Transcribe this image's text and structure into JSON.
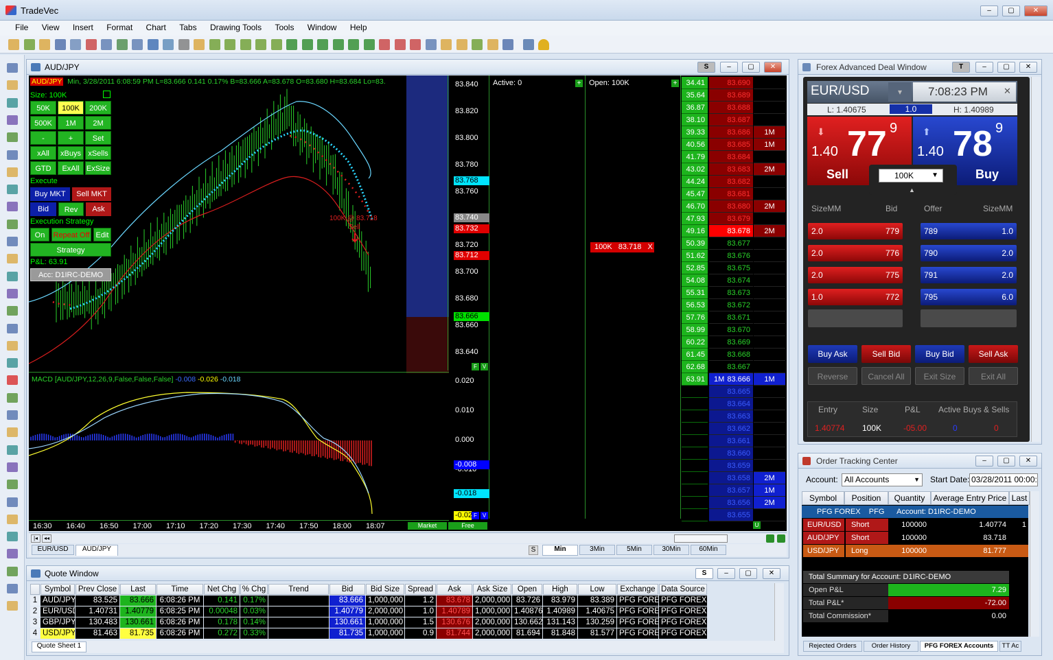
{
  "app": {
    "title": "TradeVec"
  },
  "menu": [
    "File",
    "View",
    "Insert",
    "Format",
    "Chart",
    "Tabs",
    "Drawing Tools",
    "Tools",
    "Window",
    "Help"
  ],
  "chart": {
    "title": "AUD/JPY",
    "header_symbol": "AUD/JPY",
    "header_info": "Min, 3/28/2011  6:08:59 PM  L=83.666  0.141  0.17%  B=83.666  A=83.678  O=83.680  H=83.684  Lo=83.",
    "size_label": "Size: 100K",
    "size_btns": [
      "50K",
      "100K",
      "200K",
      "500K",
      "1M",
      "2M",
      "-",
      "+",
      "Set",
      "xAll",
      "xBuys",
      "xSells",
      "GTD",
      "ExAll",
      "ExSize"
    ],
    "execute_label": "Execute",
    "buy_mkt": "Buy MKT",
    "sell_mkt": "Sell MKT",
    "bid": "Bid",
    "rev": "Rev",
    "ask": "Ask",
    "exec_strategy_label": "Execution Strategy",
    "on": "On",
    "repeat_off": "Repeat Off",
    "edit": "Edit",
    "strategy": "Strategy",
    "pnl": "P&L: 63.91",
    "account": "Acc: D1IRC-DEMO",
    "annotation": "100K @ 83.718",
    "annotation_sell": "Sell",
    "price_axis": [
      "83.840",
      "83.820",
      "83.800",
      "83.780",
      "83.760",
      "83.740",
      "83.720",
      "83.700",
      "83.680",
      "83.660",
      "83.640"
    ],
    "price_tags": [
      {
        "v": "83.768",
        "c": "#00e5ff",
        "fg": "#000"
      },
      {
        "v": "83.740",
        "c": "#888888",
        "fg": "#fff"
      },
      {
        "v": "83.732",
        "c": "#e00000",
        "fg": "#fff"
      },
      {
        "v": "83.712",
        "c": "#e00000",
        "fg": "#fff"
      },
      {
        "v": "83.666",
        "c": "#00e000",
        "fg": "#000"
      }
    ],
    "macd_label": "MACD  [AUD/JPY,12,26,9,False,False,False]",
    "macd_v1": "-0.008",
    "macd_v2": "-0.026",
    "macd_v3": "-0.018",
    "macd_axis": [
      "0.020",
      "0.010",
      "0.000",
      "-0.010"
    ],
    "macd_tags": [
      {
        "v": "-0.008",
        "c": "#0000ff",
        "fg": "#fff"
      },
      {
        "v": "-0.018",
        "c": "#00e5ff",
        "fg": "#000"
      },
      {
        "v": "-0.02",
        "c": "#ffff00",
        "fg": "#000"
      }
    ],
    "time_axis": [
      "16:30",
      "16:40",
      "16:50",
      "17:00",
      "17:10",
      "17:20",
      "17:30",
      "17:40",
      "17:50",
      "18:00",
      "18:07"
    ],
    "tabs": [
      "EUR/USD",
      "AUD/JPY"
    ],
    "intervals": [
      "S",
      "Min",
      "3Min",
      "5Min",
      "30Min",
      "60Min"
    ],
    "market": "Market",
    "free": "Free",
    "active": "Active: 0",
    "open": "Open: 100K",
    "order_tag": "100K",
    "order_price": "83.718",
    "order_x": "X"
  },
  "ladder": {
    "rows": [
      {
        "pl": "34.41",
        "price": "83.690",
        "vol": ""
      },
      {
        "pl": "35.64",
        "price": "83.689",
        "vol": ""
      },
      {
        "pl": "36.87",
        "price": "83.688",
        "vol": ""
      },
      {
        "pl": "38.10",
        "price": "83.687",
        "vol": ""
      },
      {
        "pl": "39.33",
        "price": "83.686",
        "vol": "1M"
      },
      {
        "pl": "40.56",
        "price": "83.685",
        "vol": "1M"
      },
      {
        "pl": "41.79",
        "price": "83.684",
        "vol": ""
      },
      {
        "pl": "43.02",
        "price": "83.683",
        "vol": "2M"
      },
      {
        "pl": "44.24",
        "price": "83.682",
        "vol": ""
      },
      {
        "pl": "45.47",
        "price": "83.681",
        "vol": ""
      },
      {
        "pl": "46.70",
        "price": "83.680",
        "vol": "2M"
      },
      {
        "pl": "47.93",
        "price": "83.679",
        "vol": ""
      },
      {
        "pl": "49.16",
        "price": "83.678",
        "vol": "2M"
      },
      {
        "pl": "50.39",
        "price": "83.677",
        "vol": ""
      },
      {
        "pl": "51.62",
        "price": "83.676",
        "vol": ""
      },
      {
        "pl": "52.85",
        "price": "83.675",
        "vol": ""
      },
      {
        "pl": "54.08",
        "price": "83.674",
        "vol": ""
      },
      {
        "pl": "55.31",
        "price": "83.673",
        "vol": ""
      },
      {
        "pl": "56.53",
        "price": "83.672",
        "vol": ""
      },
      {
        "pl": "57.76",
        "price": "83.671",
        "vol": ""
      },
      {
        "pl": "58.99",
        "price": "83.670",
        "vol": ""
      },
      {
        "pl": "60.22",
        "price": "83.669",
        "vol": ""
      },
      {
        "pl": "61.45",
        "price": "83.668",
        "vol": ""
      },
      {
        "pl": "62.68",
        "price": "83.667",
        "vol": ""
      },
      {
        "pl": "63.91",
        "price": "83.666",
        "vol": "1M",
        "left": "1M"
      },
      {
        "pl": "",
        "price": "83.665",
        "vol": ""
      },
      {
        "pl": "",
        "price": "83.664",
        "vol": ""
      },
      {
        "pl": "",
        "price": "83.663",
        "vol": ""
      },
      {
        "pl": "",
        "price": "83.662",
        "vol": ""
      },
      {
        "pl": "",
        "price": "83.661",
        "vol": ""
      },
      {
        "pl": "",
        "price": "83.660",
        "vol": ""
      },
      {
        "pl": "",
        "price": "83.659",
        "vol": ""
      },
      {
        "pl": "",
        "price": "83.658",
        "vol": "2M"
      },
      {
        "pl": "",
        "price": "83.657",
        "vol": "1M"
      },
      {
        "pl": "",
        "price": "83.656",
        "vol": "2M"
      },
      {
        "pl": "",
        "price": "83.655",
        "vol": ""
      }
    ]
  },
  "deal": {
    "title": "Forex Advanced Deal Window",
    "t_btn": "T",
    "pair": "EUR/USD",
    "time": "7:08:23 PM",
    "low": "L: 1.40675",
    "spread": "1.0",
    "high": "H: 1.40989",
    "sell_big": "77",
    "sell_small": "1.40",
    "sell_sup": "9",
    "buy_big": "78",
    "buy_small": "1.40",
    "buy_sup": "9",
    "sell": "Sell",
    "buy": "Buy",
    "qty": "100K",
    "hdr": [
      "SizeMM",
      "Bid",
      "Offer",
      "SizeMM"
    ],
    "bids": [
      {
        "s": "2.0",
        "p": "779"
      },
      {
        "s": "2.0",
        "p": "776"
      },
      {
        "s": "2.0",
        "p": "775"
      },
      {
        "s": "1.0",
        "p": "772"
      }
    ],
    "offers": [
      {
        "p": "789",
        "s": "1.0"
      },
      {
        "p": "790",
        "s": "2.0"
      },
      {
        "p": "791",
        "s": "2.0"
      },
      {
        "p": "795",
        "s": "6.0"
      }
    ],
    "btns": [
      "Buy Ask",
      "Sell Bid",
      "Buy Bid",
      "Sell Ask"
    ],
    "btns2": [
      "Reverse",
      "Cancel All",
      "Exit Size",
      "Exit All"
    ],
    "pos_hdr": [
      "Entry",
      "Size",
      "P&L",
      "Active Buys & Sells"
    ],
    "pos": {
      "entry": "1.40774",
      "size": "100K",
      "pnl": "-05.00",
      "buys": "0",
      "sells": "0"
    }
  },
  "otc": {
    "title": "Order Tracking Center",
    "account_label": "Account:",
    "account": "All Accounts",
    "start_label": "Start Date:",
    "start": "03/28/2011 00:00:0",
    "cols": [
      "Symbol",
      "Position",
      "Quantity",
      "Average Entry Price",
      "Last"
    ],
    "group": "PFG FOREX    PFG      Account: D1IRC-DEMO",
    "rows": [
      {
        "sym": "EUR/USD",
        "pos": "Short",
        "qty": "100000",
        "avg": "1.40774",
        "last": "1"
      },
      {
        "sym": "AUD/JPY",
        "pos": "Short",
        "qty": "100000",
        "avg": "83.718",
        "last": ""
      },
      {
        "sym": "USD/JPY",
        "pos": "Long",
        "qty": "100000",
        "avg": "81.777",
        "last": ""
      }
    ],
    "summary_title": "Total Summary for Account: D1IRC-DEMO",
    "summary": [
      {
        "k": "Open P&L",
        "v": "7.29"
      },
      {
        "k": "Total P&L*",
        "v": "-72.00"
      },
      {
        "k": "Total Commission*",
        "v": "0.00"
      }
    ],
    "tabs": [
      "Rejected Orders",
      "Order History",
      "PFG FOREX Accounts",
      "TT Ac"
    ]
  },
  "quote": {
    "title": "Quote Window",
    "cols": [
      "",
      "Symbol",
      "Prev Close",
      "Last",
      "Time",
      "Net Chg",
      "% Chg",
      "Trend",
      "Bid",
      "Bid Size",
      "Spread",
      "Ask",
      "Ask Size",
      "Open",
      "High",
      "Low",
      "Exchange",
      "Data Source"
    ],
    "rows": [
      [
        "1",
        "AUD/JPY",
        "83.525",
        "83.666",
        "6:08:26 PM",
        "0.141",
        "0.17%",
        "",
        "83.666",
        "1,000,000",
        "1.2",
        "83.678",
        "2,000,000",
        "83.726",
        "83.979",
        "83.389",
        "PFG FOREX",
        "PFG FOREX"
      ],
      [
        "2",
        "EUR/USD",
        "1.40731",
        "1.40779",
        "6:08:25 PM",
        "0.00048",
        "0.03%",
        "",
        "1.40779",
        "2,000,000",
        "1.0",
        "1.40789",
        "1,000,000",
        "1.40876",
        "1.40989",
        "1.40675",
        "PFG FOREX",
        "PFG FOREX"
      ],
      [
        "3",
        "GBP/JPY",
        "130.483",
        "130.661",
        "6:08:26 PM",
        "0.178",
        "0.14%",
        "",
        "130.661",
        "1,000,000",
        "1.5",
        "130.676",
        "2,000,000",
        "130.662",
        "131.143",
        "130.259",
        "PFG FOREX",
        "PFG FOREX"
      ],
      [
        "4",
        "USD/JPY",
        "81.463",
        "81.735",
        "6:08:26 PM",
        "0.272",
        "0.33%",
        "",
        "81.735",
        "1,000,000",
        "0.9",
        "81.744",
        "2,000,000",
        "81.694",
        "81.848",
        "81.577",
        "PFG FOREX",
        "PFG FOREX"
      ]
    ],
    "sheet": "Quote Sheet 1"
  }
}
